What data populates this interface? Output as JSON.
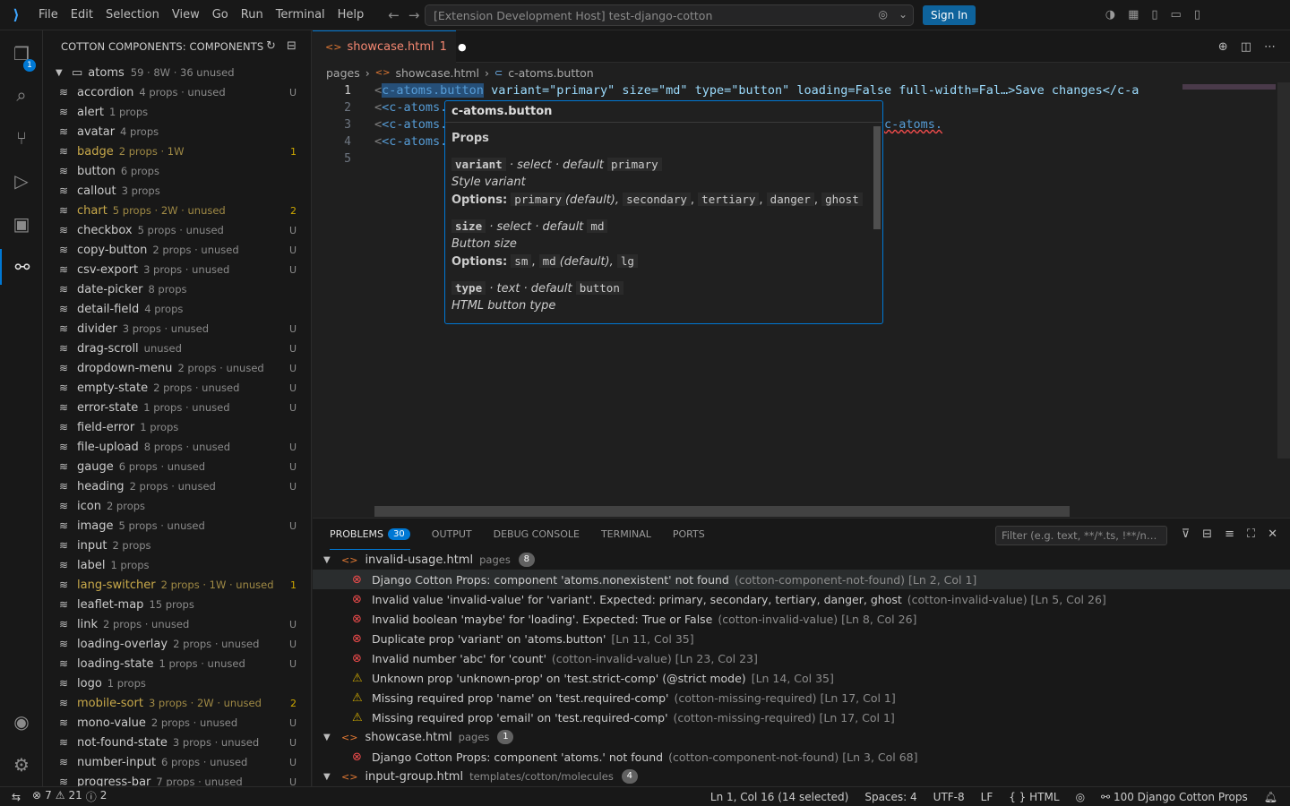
{
  "titlebar": {
    "menu": [
      "File",
      "Edit",
      "Selection",
      "View",
      "Go",
      "Run",
      "Terminal",
      "Help"
    ],
    "command_center": "[Extension Development Host] test-django-cotton",
    "sign_in": "Sign In"
  },
  "activity": {
    "explorer_badge": "1"
  },
  "sidebar": {
    "title": "COTTON COMPONENTS: COMPONENTS",
    "folder": {
      "name": "atoms",
      "desc": "59 · 8W · 36 unused"
    },
    "items": [
      {
        "name": "accordion",
        "desc": "4 props · unused",
        "dec": "U",
        "warn": false
      },
      {
        "name": "alert",
        "desc": "1 props",
        "dec": "",
        "warn": false
      },
      {
        "name": "avatar",
        "desc": "4 props",
        "dec": "",
        "warn": false
      },
      {
        "name": "badge",
        "desc": "2 props · 1W",
        "dec": "1",
        "warn": true
      },
      {
        "name": "button",
        "desc": "6 props",
        "dec": "",
        "warn": false
      },
      {
        "name": "callout",
        "desc": "3 props",
        "dec": "",
        "warn": false
      },
      {
        "name": "chart",
        "desc": "5 props · 2W · unused",
        "dec": "2",
        "warn": true
      },
      {
        "name": "checkbox",
        "desc": "5 props · unused",
        "dec": "U",
        "warn": false
      },
      {
        "name": "copy-button",
        "desc": "2 props · unused",
        "dec": "U",
        "warn": false
      },
      {
        "name": "csv-export",
        "desc": "3 props · unused",
        "dec": "U",
        "warn": false
      },
      {
        "name": "date-picker",
        "desc": "8 props",
        "dec": "",
        "warn": false
      },
      {
        "name": "detail-field",
        "desc": "4 props",
        "dec": "",
        "warn": false
      },
      {
        "name": "divider",
        "desc": "3 props · unused",
        "dec": "U",
        "warn": false
      },
      {
        "name": "drag-scroll",
        "desc": "unused",
        "dec": "U",
        "warn": false
      },
      {
        "name": "dropdown-menu",
        "desc": "2 props · unused",
        "dec": "U",
        "warn": false
      },
      {
        "name": "empty-state",
        "desc": "2 props · unused",
        "dec": "U",
        "warn": false
      },
      {
        "name": "error-state",
        "desc": "1 props · unused",
        "dec": "U",
        "warn": false
      },
      {
        "name": "field-error",
        "desc": "1 props",
        "dec": "",
        "warn": false
      },
      {
        "name": "file-upload",
        "desc": "8 props · unused",
        "dec": "U",
        "warn": false
      },
      {
        "name": "gauge",
        "desc": "6 props · unused",
        "dec": "U",
        "warn": false
      },
      {
        "name": "heading",
        "desc": "2 props · unused",
        "dec": "U",
        "warn": false
      },
      {
        "name": "icon",
        "desc": "2 props",
        "dec": "",
        "warn": false
      },
      {
        "name": "image",
        "desc": "5 props · unused",
        "dec": "U",
        "warn": false
      },
      {
        "name": "input",
        "desc": "2 props",
        "dec": "",
        "warn": false
      },
      {
        "name": "label",
        "desc": "1 props",
        "dec": "",
        "warn": false
      },
      {
        "name": "lang-switcher",
        "desc": "2 props · 1W · unused",
        "dec": "1",
        "warn": true
      },
      {
        "name": "leaflet-map",
        "desc": "15 props",
        "dec": "",
        "warn": false
      },
      {
        "name": "link",
        "desc": "2 props · unused",
        "dec": "U",
        "warn": false
      },
      {
        "name": "loading-overlay",
        "desc": "2 props · unused",
        "dec": "U",
        "warn": false
      },
      {
        "name": "loading-state",
        "desc": "1 props · unused",
        "dec": "U",
        "warn": false
      },
      {
        "name": "logo",
        "desc": "1 props",
        "dec": "",
        "warn": false
      },
      {
        "name": "mobile-sort",
        "desc": "3 props · 2W · unused",
        "dec": "2",
        "warn": true
      },
      {
        "name": "mono-value",
        "desc": "2 props · unused",
        "dec": "U",
        "warn": false
      },
      {
        "name": "not-found-state",
        "desc": "3 props · unused",
        "dec": "U",
        "warn": false
      },
      {
        "name": "number-input",
        "desc": "6 props · unused",
        "dec": "U",
        "warn": false
      },
      {
        "name": "progress-bar",
        "desc": "7 props · unused",
        "dec": "U",
        "warn": false
      }
    ]
  },
  "editor": {
    "tab": {
      "name": "showcase.html",
      "problems": "1"
    },
    "breadcrumb": [
      "pages",
      "showcase.html",
      "c-atoms.button"
    ],
    "line_numbers": [
      "1",
      "2",
      "3",
      "4",
      "5"
    ],
    "line1": {
      "tag": "c-atoms.button",
      "rest": " variant=\"primary\" size=\"md\" type=\"button\" loading=False full-width=Fal…>Save changes</c-a"
    },
    "line_prefix": "<c-atoms.",
    "line2_tail": "c-atoms."
  },
  "hover": {
    "title": "c-atoms.button",
    "props_heading": "Props",
    "props": [
      {
        "name": "variant",
        "kind": "· select · default",
        "default": "primary",
        "desc": "Style variant",
        "options_label": "Options:",
        "options": [
          "primary",
          "(default),",
          "secondary",
          ",",
          "tertiary",
          ",",
          "danger",
          ",",
          "ghost"
        ]
      },
      {
        "name": "size",
        "kind": "· select · default",
        "default": "md",
        "desc": "Button size",
        "options_label": "Options:",
        "options": [
          "sm",
          ",",
          "md",
          "(default),",
          "lg"
        ]
      },
      {
        "name": "type",
        "kind": "· text · default",
        "default": "button",
        "desc": "HTML button type"
      }
    ]
  },
  "panel": {
    "tabs": [
      "PROBLEMS",
      "OUTPUT",
      "DEBUG CONSOLE",
      "TERMINAL",
      "PORTS"
    ],
    "problems_count": "30",
    "filter_placeholder": "Filter (e.g. text, **/*.ts, !**/n…",
    "groups": [
      {
        "file": "invalid-usage.html",
        "dir": "pages",
        "count": "8",
        "items": [
          {
            "sev": "error",
            "msg": "Django Cotton Props: component 'atoms.nonexistent' not found",
            "src": "(cotton-component-not-found)  [Ln 2, Col 1]"
          },
          {
            "sev": "error",
            "msg": "Invalid value 'invalid-value' for 'variant'. Expected: primary, secondary, tertiary, danger, ghost",
            "src": "(cotton-invalid-value)  [Ln 5, Col 26]"
          },
          {
            "sev": "error",
            "msg": "Invalid boolean 'maybe' for 'loading'. Expected: True or False",
            "src": "(cotton-invalid-value)  [Ln 8, Col 26]"
          },
          {
            "sev": "error",
            "msg": "Duplicate prop 'variant' on 'atoms.button'",
            "src": "[Ln 11, Col 35]"
          },
          {
            "sev": "error",
            "msg": "Invalid number 'abc' for 'count'",
            "src": "(cotton-invalid-value)  [Ln 23, Col 23]"
          },
          {
            "sev": "warning",
            "msg": "Unknown prop 'unknown-prop' on 'test.strict-comp' (@strict mode)",
            "src": "[Ln 14, Col 35]"
          },
          {
            "sev": "warning",
            "msg": "Missing required prop 'name' on 'test.required-comp'",
            "src": "(cotton-missing-required)  [Ln 17, Col 1]"
          },
          {
            "sev": "warning",
            "msg": "Missing required prop 'email' on 'test.required-comp'",
            "src": "(cotton-missing-required)  [Ln 17, Col 1]"
          }
        ]
      },
      {
        "file": "showcase.html",
        "dir": "pages",
        "count": "1",
        "items": [
          {
            "sev": "error",
            "msg": "Django Cotton Props: component 'atoms.' not found",
            "src": "(cotton-component-not-found)  [Ln 3, Col 68]"
          }
        ]
      },
      {
        "file": "input-group.html",
        "dir": "templates/cotton/molecules",
        "count": "4",
        "items": []
      }
    ]
  },
  "status": {
    "errors": "7",
    "warnings": "21",
    "infos": "2",
    "position": "Ln 1, Col 16 (14 selected)",
    "spaces": "Spaces: 4",
    "encoding": "UTF-8",
    "eol": "LF",
    "language": "HTML",
    "extension": "100 Django Cotton Props"
  }
}
